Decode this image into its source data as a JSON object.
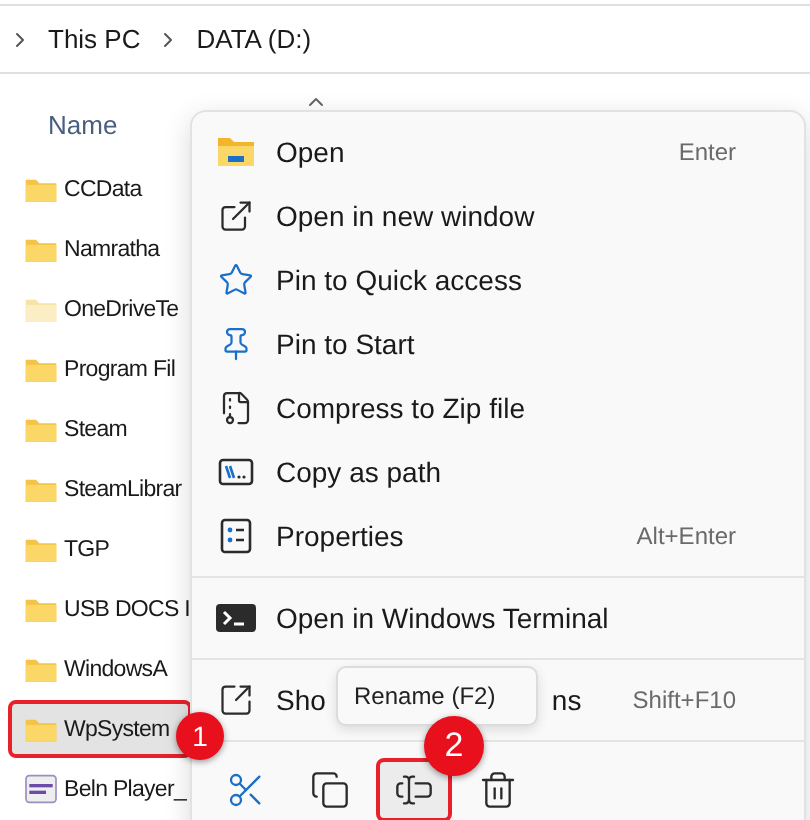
{
  "breadcrumb": [
    {
      "label": "This PC"
    },
    {
      "label": "DATA (D:)"
    }
  ],
  "column_header": {
    "label": "Name",
    "sorted_ascending": true
  },
  "files": [
    {
      "name": "CCData",
      "kind": "folder",
      "selected": false
    },
    {
      "name": "Namratha",
      "kind": "folder",
      "selected": false
    },
    {
      "name": "OneDriveTe",
      "kind": "cloud-folder",
      "selected": false
    },
    {
      "name": "Program Fil",
      "kind": "folder",
      "selected": false
    },
    {
      "name": "Steam",
      "kind": "folder",
      "selected": false
    },
    {
      "name": "SteamLibrar",
      "kind": "folder",
      "selected": false
    },
    {
      "name": "TGP",
      "kind": "folder",
      "selected": false
    },
    {
      "name": "USB DOCS I",
      "kind": "folder",
      "selected": false
    },
    {
      "name": "WindowsA",
      "kind": "folder",
      "selected": false
    },
    {
      "name": "WpSystem",
      "kind": "folder",
      "selected": true,
      "badge": "1"
    },
    {
      "name": "Beln Player_",
      "kind": "app",
      "selected": false
    }
  ],
  "context_menu": {
    "items": [
      {
        "kind": "open",
        "label": "Open",
        "shortcut": "Enter"
      },
      {
        "kind": "open-new-window",
        "label": "Open in new window"
      },
      {
        "kind": "pin-quick-access",
        "label": "Pin to Quick access"
      },
      {
        "kind": "pin-start",
        "label": "Pin to Start"
      },
      {
        "kind": "compress",
        "label": "Compress to Zip file"
      },
      {
        "kind": "copy-path",
        "label": "Copy as path"
      },
      {
        "kind": "properties",
        "label": "Properties",
        "shortcut": "Alt+Enter"
      },
      {
        "kind": "terminal",
        "label": "Open in Windows Terminal",
        "separator_before": true
      },
      {
        "kind": "more-options",
        "label": "Sho",
        "label_tail": "ns",
        "shortcut": "Shift+F10",
        "separator_before": true
      }
    ],
    "actions": [
      {
        "kind": "cut",
        "highlighted": false
      },
      {
        "kind": "copy",
        "highlighted": false
      },
      {
        "kind": "rename",
        "highlighted": true,
        "tooltip": "Rename (F2)",
        "badge": "2"
      },
      {
        "kind": "delete",
        "highlighted": false
      }
    ]
  }
}
